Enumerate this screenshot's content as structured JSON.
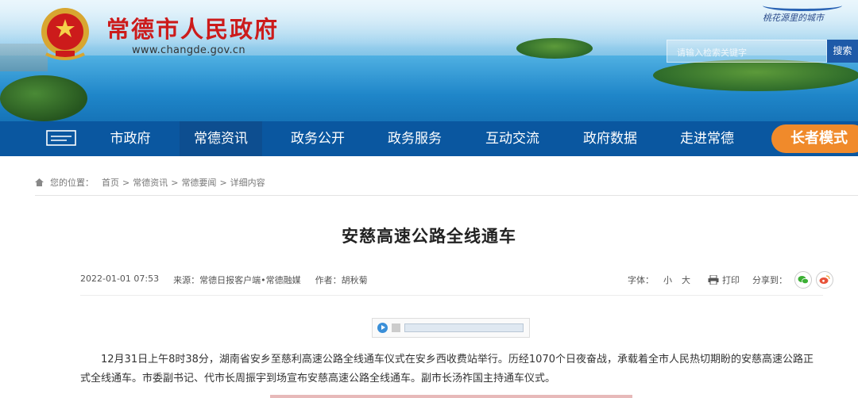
{
  "header": {
    "site_title": "常德市人民政府",
    "site_url": "www.changde.gov.cn",
    "slogan": "桃花源里的城市",
    "search": {
      "placeholder": "请输入检索关键字",
      "button_label": "搜索"
    }
  },
  "nav": {
    "items": [
      {
        "label": "市政府"
      },
      {
        "label": "常德资讯",
        "active": true
      },
      {
        "label": "政务公开"
      },
      {
        "label": "政务服务"
      },
      {
        "label": "互动交流"
      },
      {
        "label": "政府数据"
      },
      {
        "label": "走进常德"
      }
    ],
    "elder_mode_label": "长者模式"
  },
  "breadcrumb": {
    "prefix": "您的位置：",
    "items": [
      "首页",
      "常德资讯",
      "常德要闻",
      "详细内容"
    ],
    "separator": ">"
  },
  "article": {
    "title": "安慈高速公路全线通车",
    "date": "2022-01-01 07:53",
    "source": "来源：常德日报客户端•常德融媒",
    "author": "作者：胡秋菊",
    "font_label": "字体：",
    "font_small": "小",
    "font_large": "大",
    "print_label": "打印",
    "share_label": "分享到：",
    "paragraph": "12月31日上午8时38分，湖南省安乡至慈利高速公路全线通车仪式在安乡西收费站举行。历经1070个日夜奋战，承载着全市人民热切期盼的安慈高速公路正式全线通车。市委副书记、代市长周振宇到场宣布安慈高速公路全线通车。副市长汤祚国主持通车仪式。"
  },
  "colors": {
    "nav_bg": "#0a57a0",
    "title_red": "#cc1b1b",
    "elder_orange": "#f08a2b",
    "wechat_green": "#3cb034",
    "weibo_orange": "#e8533a"
  }
}
